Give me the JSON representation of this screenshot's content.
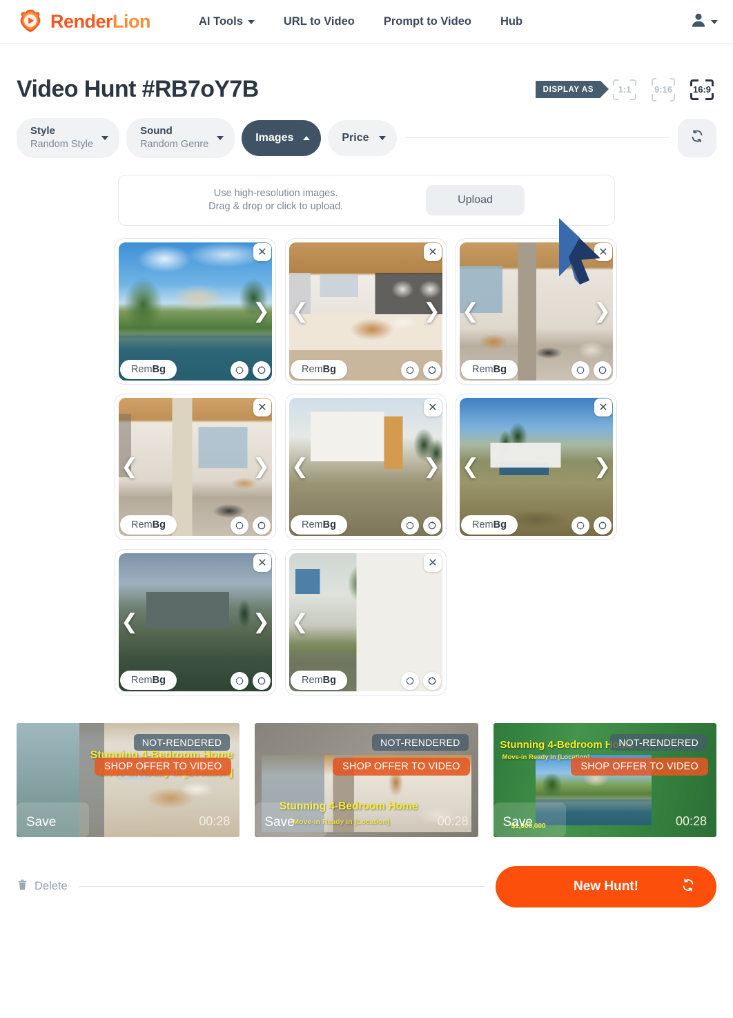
{
  "brand": {
    "part1": "Render",
    "part2": "Lion",
    "logo_icon": "lion-play-logo"
  },
  "nav": {
    "items": [
      {
        "label": "AI Tools",
        "has_caret": true
      },
      {
        "label": "URL to Video",
        "has_caret": false
      },
      {
        "label": "Prompt to Video",
        "has_caret": false
      },
      {
        "label": "Hub",
        "has_caret": false
      }
    ],
    "account_icon": "user-account-icon"
  },
  "header": {
    "title": "Video Hunt #RB7oY7B",
    "display_as_label": "DISPLAY AS",
    "ratios": [
      {
        "label": "1:1",
        "active": false
      },
      {
        "label": "9:16",
        "active": false
      },
      {
        "label": "16:9",
        "active": true
      }
    ]
  },
  "filters": {
    "style": {
      "label": "Style",
      "value": "Random Style"
    },
    "sound": {
      "label": "Sound",
      "value": "Random Genre"
    },
    "images": {
      "label": "Images",
      "active": true
    },
    "price": {
      "label": "Price"
    },
    "refresh_icon": "refresh-icon"
  },
  "upload": {
    "line1": "Use high-resolution images.",
    "line2": "Drag & drop or click to upload.",
    "button": "Upload"
  },
  "image_card": {
    "rembg_prefix": "Rem",
    "rembg_suffix": "Bg",
    "close_icon": "close-icon",
    "rotate_left_icon": "rotate-left-icon",
    "rotate_right_icon": "rotate-right-icon",
    "prev_icon": "chevron-left-icon",
    "next_icon": "chevron-right-icon"
  },
  "images": [
    {
      "alt": "villa-with-pool-and-palms",
      "has_prev": false,
      "has_next": true
    },
    {
      "alt": "bedroom-with-wood-ceiling",
      "has_prev": true,
      "has_next": true
    },
    {
      "alt": "living-room-with-kitchen-view",
      "has_prev": true,
      "has_next": true
    },
    {
      "alt": "interior-staircase-and-dining",
      "has_prev": true,
      "has_next": true
    },
    {
      "alt": "modern-house-exterior-hillside",
      "has_prev": true,
      "has_next": true
    },
    {
      "alt": "modern-villa-with-pool-landscape",
      "has_prev": true,
      "has_next": true
    },
    {
      "alt": "dusk-modern-home-exterior",
      "has_prev": true,
      "has_next": true
    },
    {
      "alt": "white-villa-with-palm-tree",
      "has_prev": true,
      "has_next": false
    }
  ],
  "videos": [
    {
      "headline": "Stunning 4-Bedroom Home",
      "subline": "Move-in Ready in [Location]",
      "badge_status": "NOT-RENDERED",
      "badge_offer": "SHOP OFFER TO VIDEO",
      "save": "Save",
      "duration": "00:28",
      "price": "",
      "theme_color": "#5f8376",
      "style": "green"
    },
    {
      "headline": "Stunning 4-Bedroom Home",
      "subline": "Move-in Ready in [Location]",
      "badge_status": "NOT-RENDERED",
      "badge_offer": "SHOP OFFER TO VIDEO",
      "save": "Save",
      "duration": "00:28",
      "price": "",
      "theme_color": "#8b8781",
      "style": "concrete"
    },
    {
      "headline": "Stunning 4-Bedroom Home",
      "subline": "Move-in Ready in [Location]",
      "badge_status": "NOT-RENDERED",
      "badge_offer": "SHOP OFFER TO VIDEO",
      "save": "Save",
      "duration": "00:28",
      "price": "$1,000,000",
      "theme_color": "#3f8a48",
      "style": "greenwood"
    }
  ],
  "footer": {
    "delete_label": "Delete",
    "delete_icon": "trash-icon",
    "new_hunt_label": "New Hunt!",
    "new_hunt_icon": "refresh-icon"
  },
  "colors": {
    "brand_orange": "#f4571f",
    "brand_orange_light": "#fb8c3a",
    "cta_orange": "#fb4f0b",
    "dark_slate": "#3f5364",
    "muted": "#7b8894",
    "cursor_blue": "#2c5594"
  }
}
